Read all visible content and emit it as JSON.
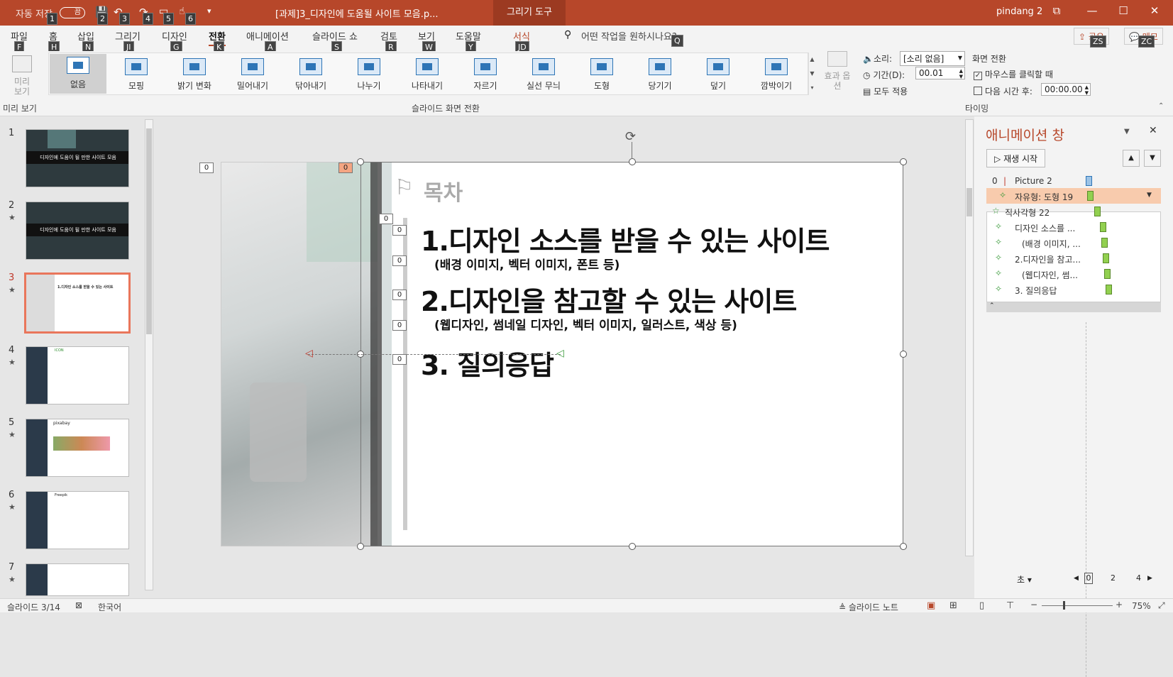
{
  "titlebar": {
    "autosave_label": "자동 저장",
    "autosave_state": "끔",
    "doc_title": "[과제]3_디자인에 도움될 사이트 모음.p...",
    "context_tab": "그리기 도구",
    "user": "pindang 2",
    "qat_keytips": [
      "1",
      "2",
      "3",
      "4",
      "5",
      "6"
    ]
  },
  "tabs": [
    {
      "label": "파일",
      "key": "F"
    },
    {
      "label": "홈",
      "key": "H"
    },
    {
      "label": "삽입",
      "key": "N"
    },
    {
      "label": "그리기",
      "key": "JI"
    },
    {
      "label": "디자인",
      "key": "G"
    },
    {
      "label": "전환",
      "key": "K"
    },
    {
      "label": "애니메이션",
      "key": "A"
    },
    {
      "label": "슬라이드 쇼",
      "key": "S"
    },
    {
      "label": "검토",
      "key": "R"
    },
    {
      "label": "보기",
      "key": "W"
    },
    {
      "label": "도움말",
      "key": "Y"
    },
    {
      "label": "서식",
      "key": "JD"
    }
  ],
  "tell_me": {
    "placeholder": "어떤 작업을 원하시나요?",
    "key": "Q"
  },
  "share": {
    "label": "공유",
    "key": "ZS"
  },
  "comments": {
    "label": "메모",
    "key": "ZC"
  },
  "ribbon": {
    "preview_label": "미리 보기",
    "preview_group": "미리 보기",
    "transitions": [
      "없음",
      "모핑",
      "밝기 변화",
      "밀어내기",
      "닦아내기",
      "나누기",
      "나타내기",
      "자르기",
      "실선 무늬",
      "도형",
      "당기기",
      "덮기",
      "깜박이기"
    ],
    "effects_label": "효과 옵션",
    "transition_group": "슬라이드 화면 전환",
    "sound_label": "소리:",
    "sound_value": "[소리 없음]",
    "duration_label": "기간(D):",
    "duration_value": "00.01",
    "apply_all": "모두 적용",
    "advance_header": "화면 전환",
    "on_click": "마우스를 클릭할 때",
    "after_label": "다음 시간 후:",
    "after_value": "00:00.00",
    "timing_group": "타이밍"
  },
  "thumbnails": [
    {
      "num": "1",
      "star": "",
      "title": "디자인에 도움이 될 만한 사이트 모음"
    },
    {
      "num": "2",
      "star": "★",
      "title": "디자인에 도움이 될 만한 사이트 모음"
    },
    {
      "num": "3",
      "star": "★",
      "title": "1.디자인 소스를 받을 수 있는 사이트"
    },
    {
      "num": "4",
      "star": "★",
      "title": "ICON"
    },
    {
      "num": "5",
      "star": "★",
      "title": "pixabay"
    },
    {
      "num": "6",
      "star": "★",
      "title": "Freepik"
    },
    {
      "num": "7",
      "star": "★",
      "title": ""
    }
  ],
  "slide": {
    "heading": "목차",
    "item1": "1.디자인 소스를 받을 수 있는 사이트",
    "item1_sub": "(배경 이미지, 벡터 이미지, 폰트 등)",
    "item2": "2.디자인을 참고할 수 있는 사이트",
    "item2_sub": "(웹디자인, 썸네일 디자인, 벡터 이미지, 일러스트, 색상 등)",
    "item3": "3. 질의응답",
    "anim_tags": [
      "0",
      "0",
      "0",
      "0",
      "0",
      "0",
      "0",
      "0"
    ]
  },
  "animpane": {
    "title": "애니메이션 창",
    "play": "재생 시작",
    "items": [
      {
        "num": "0",
        "label": "Picture 2"
      },
      {
        "num": "",
        "label": "자유형: 도형 19"
      },
      {
        "num": "",
        "label": "직사각형 22"
      },
      {
        "num": "",
        "label": "디자인 소스를 ..."
      },
      {
        "num": "",
        "label": "(배경 이미지, ..."
      },
      {
        "num": "",
        "label": "2.디자인을 참고..."
      },
      {
        "num": "",
        "label": "(웹디자인, 썸..."
      },
      {
        "num": "",
        "label": "3. 질의응답"
      }
    ],
    "seconds_label": "초",
    "timeline": [
      "0",
      "2",
      "4"
    ]
  },
  "status": {
    "slide_pos": "슬라이드 3/14",
    "language": "한국어",
    "notes": "슬라이드 노트",
    "zoom": "75%"
  },
  "colors": {
    "brand": "#b7472a",
    "selected_thumb": "#e9765b",
    "anim_green": "#92d050"
  }
}
